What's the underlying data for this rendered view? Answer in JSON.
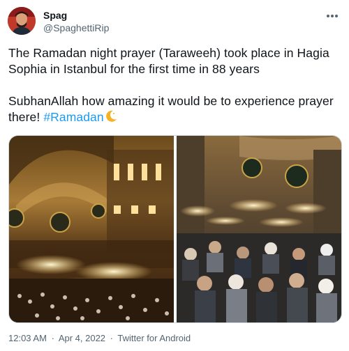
{
  "author": {
    "display_name": "Spag",
    "handle": "@SpaghettiRip"
  },
  "tweet": {
    "line1": "The Ramadan night prayer (Taraweeh) took place in Hagia Sophia in Istanbul for the first time in 88 years",
    "line2_prefix": "SubhanAllah how amazing it would be to experience prayer there! ",
    "hashtag": "#Ramadan"
  },
  "footer": {
    "time": "12:03 AM",
    "sep1": "·",
    "date": "Apr 4, 2022",
    "sep2": "·",
    "source": "Twitter for Android"
  },
  "icons": {
    "more": "more-options-icon",
    "moon": "crescent-moon-emoji"
  },
  "colors": {
    "link": "#1d9bf0",
    "secondary_text": "#536471"
  }
}
